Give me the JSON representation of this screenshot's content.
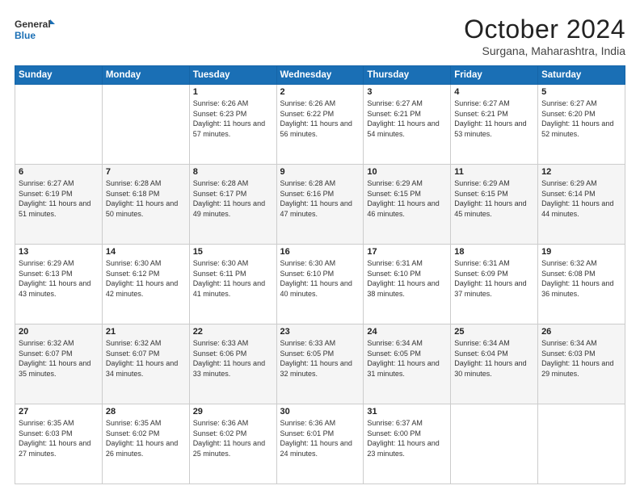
{
  "logo": {
    "line1": "General",
    "line2": "Blue"
  },
  "header": {
    "month": "October 2024",
    "location": "Surgana, Maharashtra, India"
  },
  "days_of_week": [
    "Sunday",
    "Monday",
    "Tuesday",
    "Wednesday",
    "Thursday",
    "Friday",
    "Saturday"
  ],
  "weeks": [
    [
      {
        "day": "",
        "sunrise": "",
        "sunset": "",
        "daylight": ""
      },
      {
        "day": "",
        "sunrise": "",
        "sunset": "",
        "daylight": ""
      },
      {
        "day": "1",
        "sunrise": "Sunrise: 6:26 AM",
        "sunset": "Sunset: 6:23 PM",
        "daylight": "Daylight: 11 hours and 57 minutes."
      },
      {
        "day": "2",
        "sunrise": "Sunrise: 6:26 AM",
        "sunset": "Sunset: 6:22 PM",
        "daylight": "Daylight: 11 hours and 56 minutes."
      },
      {
        "day": "3",
        "sunrise": "Sunrise: 6:27 AM",
        "sunset": "Sunset: 6:21 PM",
        "daylight": "Daylight: 11 hours and 54 minutes."
      },
      {
        "day": "4",
        "sunrise": "Sunrise: 6:27 AM",
        "sunset": "Sunset: 6:21 PM",
        "daylight": "Daylight: 11 hours and 53 minutes."
      },
      {
        "day": "5",
        "sunrise": "Sunrise: 6:27 AM",
        "sunset": "Sunset: 6:20 PM",
        "daylight": "Daylight: 11 hours and 52 minutes."
      }
    ],
    [
      {
        "day": "6",
        "sunrise": "Sunrise: 6:27 AM",
        "sunset": "Sunset: 6:19 PM",
        "daylight": "Daylight: 11 hours and 51 minutes."
      },
      {
        "day": "7",
        "sunrise": "Sunrise: 6:28 AM",
        "sunset": "Sunset: 6:18 PM",
        "daylight": "Daylight: 11 hours and 50 minutes."
      },
      {
        "day": "8",
        "sunrise": "Sunrise: 6:28 AM",
        "sunset": "Sunset: 6:17 PM",
        "daylight": "Daylight: 11 hours and 49 minutes."
      },
      {
        "day": "9",
        "sunrise": "Sunrise: 6:28 AM",
        "sunset": "Sunset: 6:16 PM",
        "daylight": "Daylight: 11 hours and 47 minutes."
      },
      {
        "day": "10",
        "sunrise": "Sunrise: 6:29 AM",
        "sunset": "Sunset: 6:15 PM",
        "daylight": "Daylight: 11 hours and 46 minutes."
      },
      {
        "day": "11",
        "sunrise": "Sunrise: 6:29 AM",
        "sunset": "Sunset: 6:15 PM",
        "daylight": "Daylight: 11 hours and 45 minutes."
      },
      {
        "day": "12",
        "sunrise": "Sunrise: 6:29 AM",
        "sunset": "Sunset: 6:14 PM",
        "daylight": "Daylight: 11 hours and 44 minutes."
      }
    ],
    [
      {
        "day": "13",
        "sunrise": "Sunrise: 6:29 AM",
        "sunset": "Sunset: 6:13 PM",
        "daylight": "Daylight: 11 hours and 43 minutes."
      },
      {
        "day": "14",
        "sunrise": "Sunrise: 6:30 AM",
        "sunset": "Sunset: 6:12 PM",
        "daylight": "Daylight: 11 hours and 42 minutes."
      },
      {
        "day": "15",
        "sunrise": "Sunrise: 6:30 AM",
        "sunset": "Sunset: 6:11 PM",
        "daylight": "Daylight: 11 hours and 41 minutes."
      },
      {
        "day": "16",
        "sunrise": "Sunrise: 6:30 AM",
        "sunset": "Sunset: 6:10 PM",
        "daylight": "Daylight: 11 hours and 40 minutes."
      },
      {
        "day": "17",
        "sunrise": "Sunrise: 6:31 AM",
        "sunset": "Sunset: 6:10 PM",
        "daylight": "Daylight: 11 hours and 38 minutes."
      },
      {
        "day": "18",
        "sunrise": "Sunrise: 6:31 AM",
        "sunset": "Sunset: 6:09 PM",
        "daylight": "Daylight: 11 hours and 37 minutes."
      },
      {
        "day": "19",
        "sunrise": "Sunrise: 6:32 AM",
        "sunset": "Sunset: 6:08 PM",
        "daylight": "Daylight: 11 hours and 36 minutes."
      }
    ],
    [
      {
        "day": "20",
        "sunrise": "Sunrise: 6:32 AM",
        "sunset": "Sunset: 6:07 PM",
        "daylight": "Daylight: 11 hours and 35 minutes."
      },
      {
        "day": "21",
        "sunrise": "Sunrise: 6:32 AM",
        "sunset": "Sunset: 6:07 PM",
        "daylight": "Daylight: 11 hours and 34 minutes."
      },
      {
        "day": "22",
        "sunrise": "Sunrise: 6:33 AM",
        "sunset": "Sunset: 6:06 PM",
        "daylight": "Daylight: 11 hours and 33 minutes."
      },
      {
        "day": "23",
        "sunrise": "Sunrise: 6:33 AM",
        "sunset": "Sunset: 6:05 PM",
        "daylight": "Daylight: 11 hours and 32 minutes."
      },
      {
        "day": "24",
        "sunrise": "Sunrise: 6:34 AM",
        "sunset": "Sunset: 6:05 PM",
        "daylight": "Daylight: 11 hours and 31 minutes."
      },
      {
        "day": "25",
        "sunrise": "Sunrise: 6:34 AM",
        "sunset": "Sunset: 6:04 PM",
        "daylight": "Daylight: 11 hours and 30 minutes."
      },
      {
        "day": "26",
        "sunrise": "Sunrise: 6:34 AM",
        "sunset": "Sunset: 6:03 PM",
        "daylight": "Daylight: 11 hours and 29 minutes."
      }
    ],
    [
      {
        "day": "27",
        "sunrise": "Sunrise: 6:35 AM",
        "sunset": "Sunset: 6:03 PM",
        "daylight": "Daylight: 11 hours and 27 minutes."
      },
      {
        "day": "28",
        "sunrise": "Sunrise: 6:35 AM",
        "sunset": "Sunset: 6:02 PM",
        "daylight": "Daylight: 11 hours and 26 minutes."
      },
      {
        "day": "29",
        "sunrise": "Sunrise: 6:36 AM",
        "sunset": "Sunset: 6:02 PM",
        "daylight": "Daylight: 11 hours and 25 minutes."
      },
      {
        "day": "30",
        "sunrise": "Sunrise: 6:36 AM",
        "sunset": "Sunset: 6:01 PM",
        "daylight": "Daylight: 11 hours and 24 minutes."
      },
      {
        "day": "31",
        "sunrise": "Sunrise: 6:37 AM",
        "sunset": "Sunset: 6:00 PM",
        "daylight": "Daylight: 11 hours and 23 minutes."
      },
      {
        "day": "",
        "sunrise": "",
        "sunset": "",
        "daylight": ""
      },
      {
        "day": "",
        "sunrise": "",
        "sunset": "",
        "daylight": ""
      }
    ]
  ]
}
